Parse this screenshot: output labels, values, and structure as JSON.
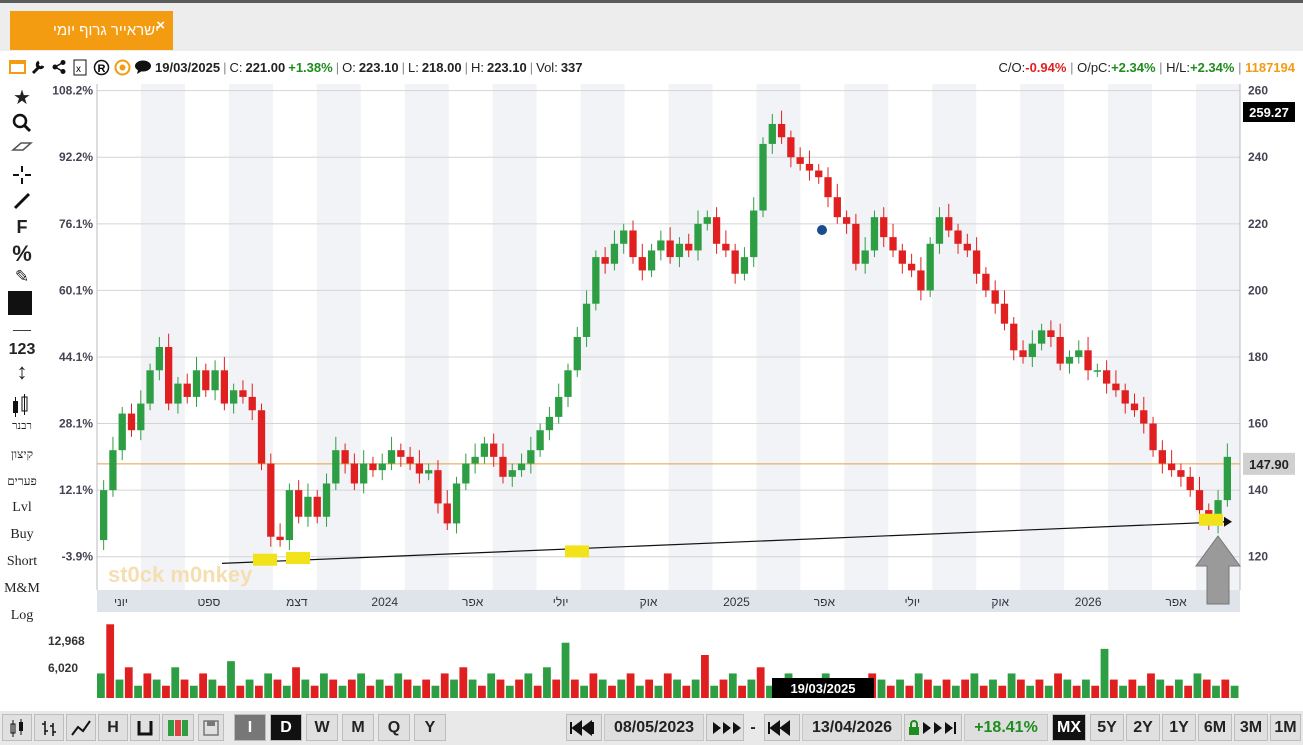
{
  "tab": {
    "title": "ישראייר גרוף יומי",
    "close": "×"
  },
  "info": {
    "date": "19/03/2025",
    "close_label": "C:",
    "close": "221.00",
    "change": "+1.38%",
    "open_label": "O:",
    "open": "223.10",
    "low_label": "L:",
    "low": "218.00",
    "high_label": "H:",
    "high": "223.10",
    "vol_label": "Vol:",
    "vol": "337",
    "co_label": "C/O:",
    "co": "-0.94%",
    "opc_label": "O/pC:",
    "opc": "+2.34%",
    "hl_label": "H/L:",
    "hl": "+2.34%",
    "count": "1187194"
  },
  "sidebar": {
    "star": "★",
    "zoom": "🔍",
    "eraser": "▱",
    "crosshair": "+",
    "line": "/",
    "fib": "F",
    "percent": "%",
    "edit": "✎",
    "color": "■",
    "dash": "—",
    "num": "123",
    "arrows": "↕",
    "candles_label": "רבנר",
    "lines": [
      "קיצון",
      "פערים",
      "Lvl",
      "Buy",
      "Short",
      "M&M",
      "Log"
    ]
  },
  "watermark": "st0ck m0nkey",
  "volume_labels": [
    "12,968",
    "6,020"
  ],
  "cursor_date": "19/03/2025",
  "chart_data": {
    "type": "line",
    "title": "",
    "y_right": {
      "range": [
        110,
        262
      ],
      "ticks": [
        120,
        140,
        160,
        180,
        200,
        220,
        240,
        260
      ]
    },
    "y_left_pct_ticks": [
      "108.2%",
      "92.2%",
      "76.1%",
      "60.1%",
      "44.1%",
      "28.1%",
      "12.1%",
      "-3.9%"
    ],
    "x_labels": [
      "יוני",
      "ספט",
      "דצמ",
      "2024",
      "אפר",
      "יולי",
      "אוק",
      "2025",
      "אפר",
      "יולי",
      "אוק",
      "2026",
      "אפר"
    ],
    "last_price": "147.90",
    "top_label": "259.27",
    "hline": 147.9,
    "trendline": {
      "from": 118,
      "to": 130.5
    },
    "series": [
      {
        "values": [
          125,
          140,
          152,
          163,
          158,
          166,
          176,
          183,
          166,
          172,
          168,
          176,
          170,
          176,
          166,
          170,
          168,
          164,
          148,
          126,
          125,
          140,
          132,
          138,
          132,
          142,
          152,
          148,
          142,
          148,
          146,
          148,
          152,
          150,
          148,
          145,
          146,
          136,
          130,
          142,
          148,
          150,
          154,
          150,
          144,
          146,
          148,
          152,
          158,
          162,
          168,
          176,
          186,
          196,
          210,
          208,
          214,
          218,
          210,
          206,
          212,
          215,
          210,
          214,
          212,
          220,
          222,
          214,
          212,
          205,
          210,
          224,
          244,
          250,
          246,
          240,
          238,
          236,
          234,
          228,
          222,
          220,
          208,
          212,
          222,
          216,
          212,
          208,
          206,
          200,
          214,
          222,
          218,
          214,
          212,
          205,
          200,
          196,
          190,
          182,
          180,
          184,
          188,
          186,
          178,
          180,
          182,
          176,
          176,
          172,
          170,
          166,
          164,
          160,
          152,
          148,
          146,
          144,
          140,
          134,
          130,
          137,
          150
        ]
      }
    ],
    "volume": {
      "values": [
        4,
        12,
        3,
        5,
        2,
        4,
        3,
        2,
        5,
        3,
        2,
        4,
        3,
        2,
        6,
        2,
        3,
        2,
        4,
        3,
        2,
        5,
        3,
        2,
        4,
        3,
        2,
        3,
        4,
        2,
        3,
        2,
        4,
        3,
        2,
        3,
        2,
        4,
        3,
        5,
        3,
        2,
        4,
        3,
        2,
        3,
        4,
        2,
        5,
        3,
        9,
        3,
        2,
        4,
        3,
        2,
        3,
        4,
        2,
        3,
        2,
        4,
        3,
        2,
        3,
        7,
        2,
        3,
        4,
        2,
        3,
        5,
        2,
        3,
        4,
        2,
        3,
        2,
        4,
        3,
        2,
        3,
        2,
        4,
        3,
        2,
        3,
        2,
        4,
        3,
        2,
        3,
        2,
        3,
        4,
        2,
        3,
        2,
        4,
        3,
        2,
        3,
        2,
        4,
        3,
        2,
        3,
        2,
        8,
        3,
        2,
        3,
        2,
        4,
        3,
        2,
        3,
        2,
        4,
        3,
        2,
        3,
        2
      ]
    }
  },
  "bottombar": {
    "tools": [
      "I",
      "D",
      "W",
      "M",
      "Q",
      "Y"
    ],
    "from_date": "08/05/2023",
    "dash": "-",
    "to_date": "13/04/2026",
    "range_change": "+18.41%",
    "ranges": [
      "MX",
      "5Y",
      "2Y",
      "1Y",
      "6M",
      "3M",
      "1M"
    ],
    "h_label": "H"
  }
}
